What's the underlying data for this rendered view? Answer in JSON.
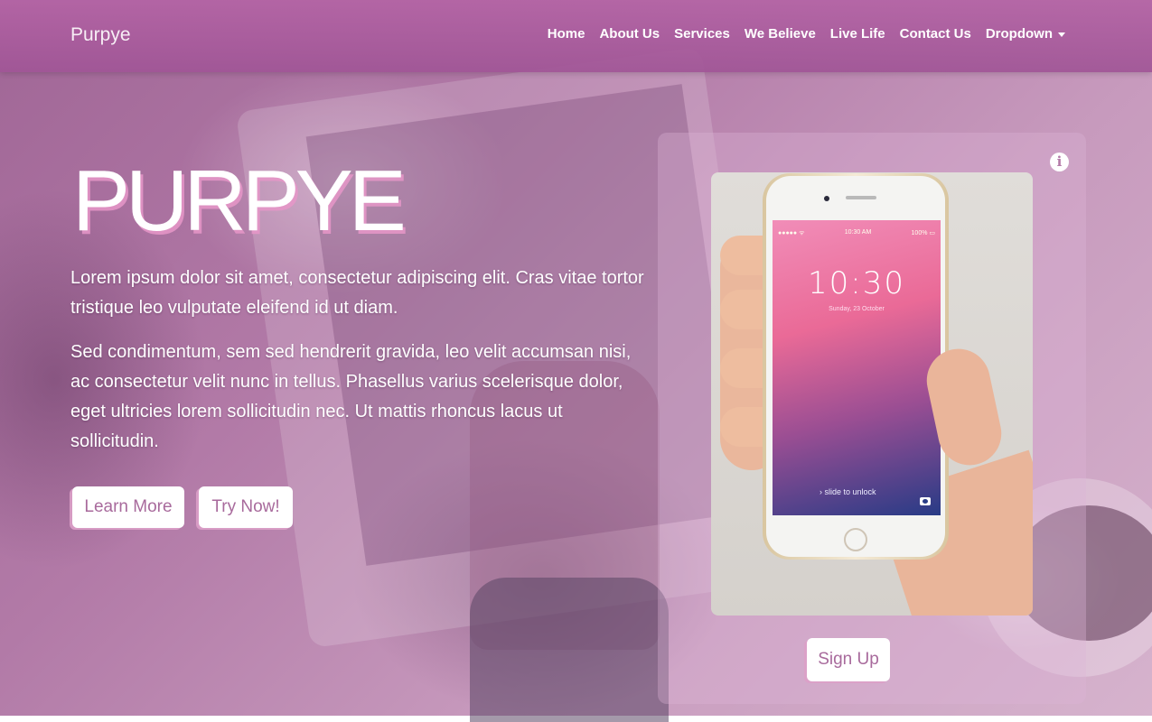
{
  "navbar": {
    "brand": "Purpye",
    "items": [
      {
        "label": "Home"
      },
      {
        "label": "About Us"
      },
      {
        "label": "Services"
      },
      {
        "label": "We Believe"
      },
      {
        "label": "Live Life"
      },
      {
        "label": "Contact Us"
      },
      {
        "label": "Dropdown"
      }
    ]
  },
  "hero": {
    "title": "PURPYE",
    "lead1": "Lorem ipsum dolor sit amet, consectetur adipiscing elit. Cras vitae tortor tristique leo vulputate eleifend id ut diam.",
    "lead2": "Sed condimentum, sem sed hendrerit gravida, leo velit accumsan nisi, ac consectetur velit nunc in tellus. Phasellus varius scelerisque dolor, eget ultricies lorem sollicitudin nec. Ut mattis rhoncus lacus ut sollicitudin.",
    "learn_more": "Learn More",
    "try_now": "Try Now!"
  },
  "card": {
    "info_icon": "info-circle-icon",
    "phone_screen": {
      "time": "10:30",
      "date": "Sunday, 23 October",
      "status_left": "●●●●● ᯤ",
      "status_center": "10:30 AM",
      "status_right": "100% ▭",
      "unlock": "› slide to unlock"
    },
    "signup": "Sign Up"
  },
  "colors": {
    "accent": "#a86a9c",
    "navbar": "#b06aa2",
    "title_shadow": "#e696c8"
  }
}
